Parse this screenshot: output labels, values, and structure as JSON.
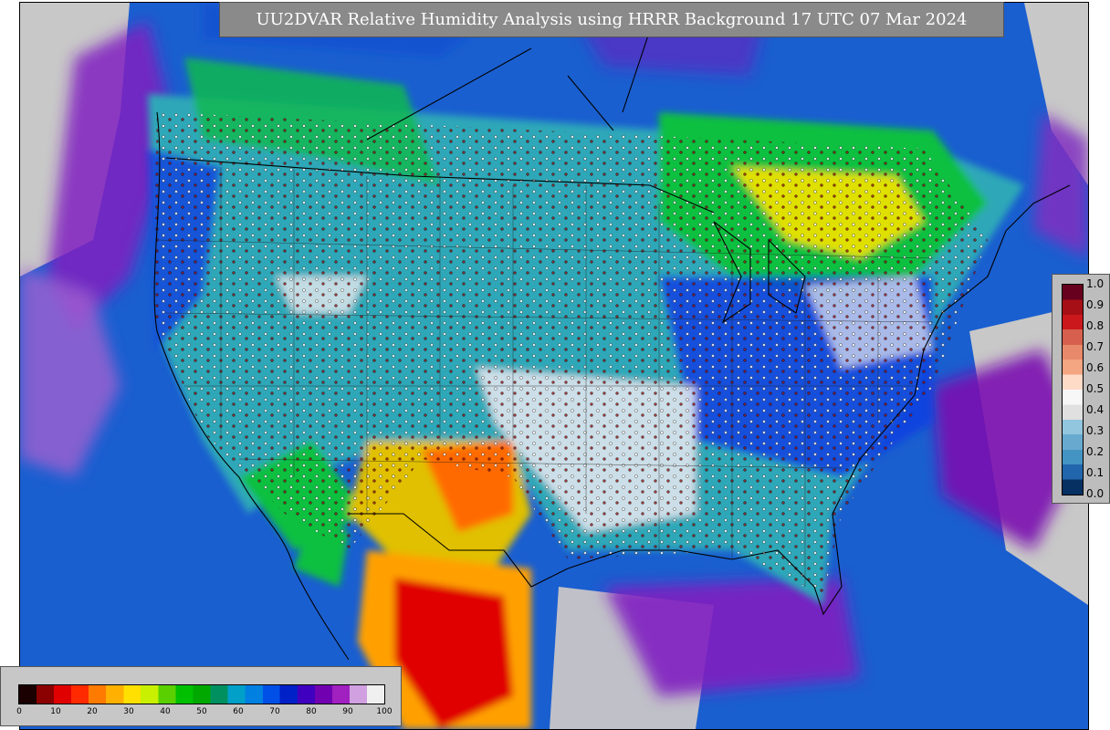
{
  "title": "UU2DVAR Relative Humidity Analysis using HRRR Background 17 UTC 07 Mar 2024",
  "rh_legend": {
    "labels": [
      "1.0",
      "0.9",
      "0.8",
      "0.7",
      "0.6",
      "0.5",
      "0.4",
      "0.3",
      "0.2",
      "0.1",
      "0.0"
    ],
    "colors_top_to_bottom": [
      "#67001f",
      "#a50f15",
      "#cb181d",
      "#d6604d",
      "#e8896b",
      "#f4a582",
      "#fddbc7",
      "#f7f7f7",
      "#e0e0e0",
      "#92c5de",
      "#67a9cf",
      "#4393c3",
      "#2166ac",
      "#053061"
    ]
  },
  "pct_legend": {
    "ticks": [
      "0",
      "10",
      "20",
      "30",
      "40",
      "50",
      "60",
      "70",
      "80",
      "90",
      "100"
    ],
    "colors": [
      "#1a0000",
      "#8b0000",
      "#e00000",
      "#ff2a00",
      "#ff7a00",
      "#ffb000",
      "#ffe000",
      "#c8f000",
      "#5ad000",
      "#00c000",
      "#00a800",
      "#009060",
      "#00a0c8",
      "#0080e0",
      "#0050e8",
      "#0020c8",
      "#4000c0",
      "#7000b0",
      "#a020c0",
      "#d0a0e0",
      "#f0f0f0"
    ]
  },
  "colors": {
    "ocean": "#1a5fd0",
    "land_blue": "#1040e0",
    "land_cyan": "#2ea8b8",
    "land_green": "#10c040",
    "land_yellow": "#e0e000",
    "land_orange": "#ff8000",
    "land_red": "#e00000",
    "land_white": "#e8e8ee",
    "purple": "#9000c0",
    "gray_offgrid": "#c8c8c8"
  }
}
